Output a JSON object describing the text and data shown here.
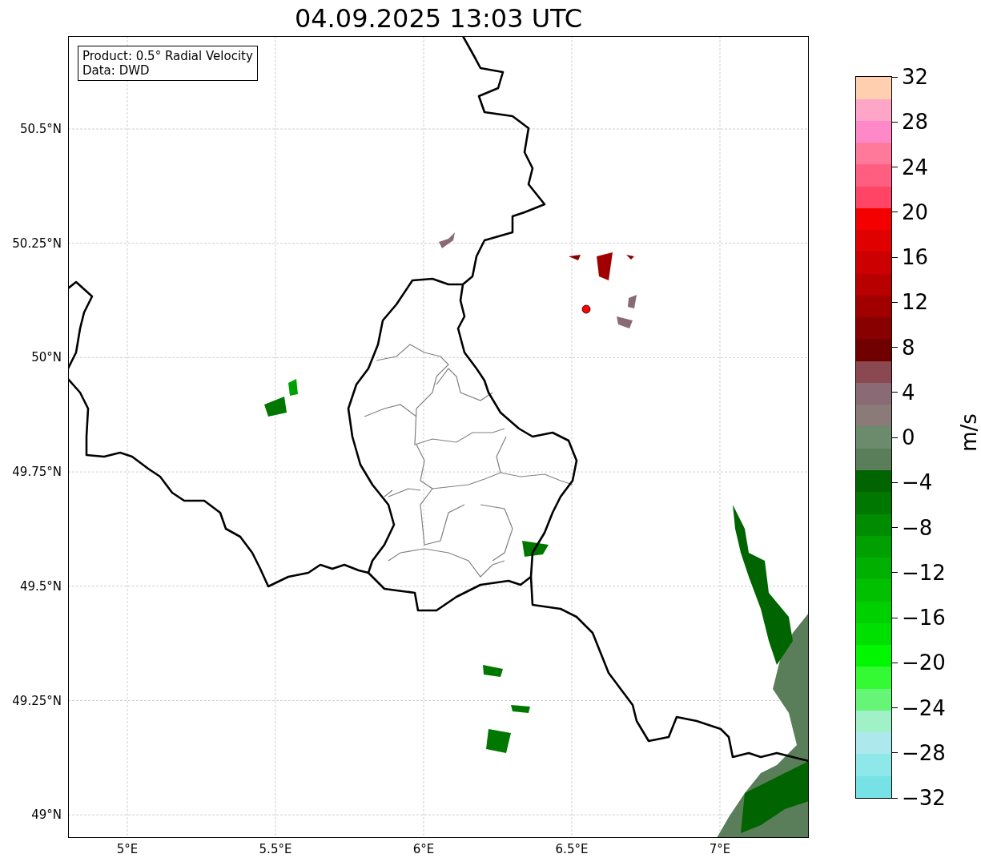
{
  "title": "04.09.2025 13:03 UTC",
  "info_box": [
    "Product: 0.5° Radial Velocity",
    "Data: DWD"
  ],
  "map": {
    "lat_ticks": [
      "50.5°N",
      "50.25°N",
      "50°N",
      "49.75°N",
      "49.5°N",
      "49.25°N",
      "49°N"
    ],
    "lon_ticks": [
      "5°E",
      "5.5°E",
      "6°E",
      "6.5°E",
      "7°E"
    ]
  },
  "colorbar": {
    "label": "m/s",
    "ticks": [
      "32",
      "28",
      "24",
      "20",
      "16",
      "12",
      "8",
      "4",
      "0",
      "−4",
      "−8",
      "−12",
      "−16",
      "−20",
      "−24",
      "−28",
      "−32"
    ],
    "bands": [
      {
        "color": "#76e2e6"
      },
      {
        "color": "#8ee8ea"
      },
      {
        "color": "#ace8ec"
      },
      {
        "color": "#a0f0c8"
      },
      {
        "color": "#66f577"
      },
      {
        "color": "#33fa33"
      },
      {
        "color": "#00f700"
      },
      {
        "color": "#00e000"
      },
      {
        "color": "#00d000"
      },
      {
        "color": "#00c000"
      },
      {
        "color": "#00b000"
      },
      {
        "color": "#00a000"
      },
      {
        "color": "#008c00"
      },
      {
        "color": "#007800"
      },
      {
        "color": "#006400"
      },
      {
        "color": "#5a7d5a"
      },
      {
        "color": "#6c8a6c"
      },
      {
        "color": "#8a7a78"
      },
      {
        "color": "#8a6a74"
      },
      {
        "color": "#8a4850"
      },
      {
        "color": "#700000"
      },
      {
        "color": "#880000"
      },
      {
        "color": "#a00000"
      },
      {
        "color": "#b80000"
      },
      {
        "color": "#cc0000"
      },
      {
        "color": "#e00000"
      },
      {
        "color": "#f50000"
      },
      {
        "color": "#ff4466"
      },
      {
        "color": "#ff5e80"
      },
      {
        "color": "#ff7a9a"
      },
      {
        "color": "#ff88c8"
      },
      {
        "color": "#ffa6c8"
      },
      {
        "color": "#ffcfb0"
      }
    ]
  }
}
